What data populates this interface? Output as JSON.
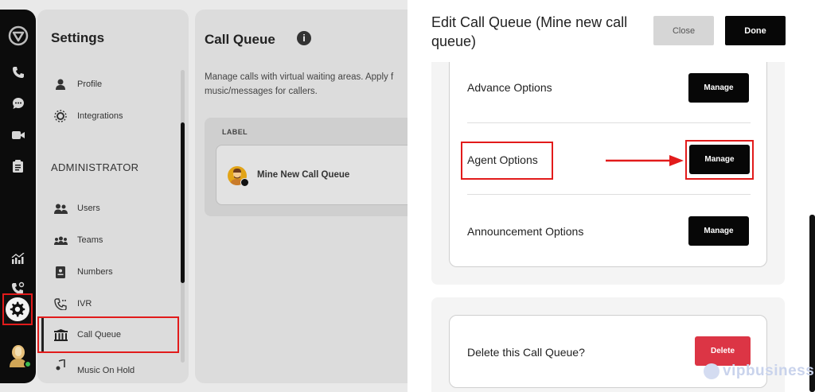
{
  "rail": {
    "icons": [
      "logo-icon",
      "phone-icon",
      "chat-icon",
      "video-icon",
      "notes-icon",
      "analytics-icon",
      "call-settings-icon",
      "gear-icon"
    ]
  },
  "settings": {
    "title": "Settings",
    "items": [
      {
        "label": "Profile",
        "icon": "person-icon"
      },
      {
        "label": "Integrations",
        "icon": "integrations-icon"
      }
    ],
    "admin_label": "ADMINISTRATOR",
    "admin_items": [
      {
        "label": "Users",
        "icon": "users-icon"
      },
      {
        "label": "Teams",
        "icon": "teams-icon"
      },
      {
        "label": "Numbers",
        "icon": "numbers-icon"
      },
      {
        "label": "IVR",
        "icon": "ivr-icon"
      },
      {
        "label": "Call Queue",
        "icon": "call-queue-icon"
      },
      {
        "label": "Music On Hold",
        "icon": "music-icon"
      }
    ]
  },
  "main": {
    "title": "Call Queue",
    "description": "Manage calls with virtual waiting areas. Apply f music/messages for callers.",
    "column_label": "LABEL",
    "queue_name": "Mine New Call Queue"
  },
  "panel": {
    "title": "Edit Call Queue (Mine new call queue)",
    "close_label": "Close",
    "done_label": "Done",
    "options": [
      {
        "label": "Advance Options",
        "button": "Manage"
      },
      {
        "label": "Agent Options",
        "button": "Manage"
      },
      {
        "label": "Announcement Options",
        "button": "Manage"
      }
    ],
    "delete_label": "Delete this Call Queue?",
    "delete_button": "Delete"
  },
  "watermark": "vipbusiness",
  "colors": {
    "highlight": "#e21b1b",
    "primary_button": "#070707",
    "danger_button": "#dc3545",
    "online": "#3dbb4f"
  }
}
